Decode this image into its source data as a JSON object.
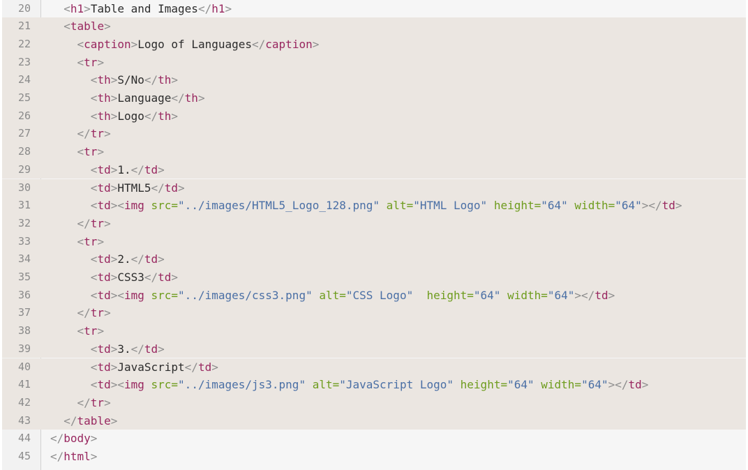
{
  "editor": {
    "highlight_color": "#ebe6e1",
    "highlighted_lines": [
      "21",
      "22",
      "23",
      "24",
      "25",
      "26",
      "27",
      "28",
      "29",
      "30",
      "31",
      "32",
      "33",
      "34",
      "35",
      "36",
      "37",
      "38",
      "39",
      "40",
      "41",
      "42",
      "43"
    ],
    "lines": [
      {
        "number": "20",
        "indent": "  ",
        "tokens": [
          {
            "t": "p",
            "v": "<"
          },
          {
            "t": "t",
            "v": "h1"
          },
          {
            "t": "p",
            "v": ">"
          },
          {
            "t": "x",
            "v": "Table and Images"
          },
          {
            "t": "p",
            "v": "</"
          },
          {
            "t": "t",
            "v": "h1"
          },
          {
            "t": "p",
            "v": ">"
          }
        ]
      },
      {
        "number": "21",
        "indent": "  ",
        "tokens": [
          {
            "t": "p",
            "v": "<"
          },
          {
            "t": "t",
            "v": "table"
          },
          {
            "t": "p",
            "v": ">"
          }
        ]
      },
      {
        "number": "22",
        "indent": "    ",
        "tokens": [
          {
            "t": "p",
            "v": "<"
          },
          {
            "t": "t",
            "v": "caption"
          },
          {
            "t": "p",
            "v": ">"
          },
          {
            "t": "x",
            "v": "Logo of Languages"
          },
          {
            "t": "p",
            "v": "</"
          },
          {
            "t": "t",
            "v": "caption"
          },
          {
            "t": "p",
            "v": ">"
          }
        ]
      },
      {
        "number": "23",
        "indent": "    ",
        "tokens": [
          {
            "t": "p",
            "v": "<"
          },
          {
            "t": "t",
            "v": "tr"
          },
          {
            "t": "p",
            "v": ">"
          }
        ]
      },
      {
        "number": "24",
        "indent": "      ",
        "tokens": [
          {
            "t": "p",
            "v": "<"
          },
          {
            "t": "t",
            "v": "th"
          },
          {
            "t": "p",
            "v": ">"
          },
          {
            "t": "x",
            "v": "S/No"
          },
          {
            "t": "p",
            "v": "</"
          },
          {
            "t": "t",
            "v": "th"
          },
          {
            "t": "p",
            "v": ">"
          }
        ]
      },
      {
        "number": "25",
        "indent": "      ",
        "tokens": [
          {
            "t": "p",
            "v": "<"
          },
          {
            "t": "t",
            "v": "th"
          },
          {
            "t": "p",
            "v": ">"
          },
          {
            "t": "x",
            "v": "Language"
          },
          {
            "t": "p",
            "v": "</"
          },
          {
            "t": "t",
            "v": "th"
          },
          {
            "t": "p",
            "v": ">"
          }
        ]
      },
      {
        "number": "26",
        "indent": "      ",
        "tokens": [
          {
            "t": "p",
            "v": "<"
          },
          {
            "t": "t",
            "v": "th"
          },
          {
            "t": "p",
            "v": ">"
          },
          {
            "t": "x",
            "v": "Logo"
          },
          {
            "t": "p",
            "v": "</"
          },
          {
            "t": "t",
            "v": "th"
          },
          {
            "t": "p",
            "v": ">"
          }
        ]
      },
      {
        "number": "27",
        "indent": "    ",
        "tokens": [
          {
            "t": "p",
            "v": "</"
          },
          {
            "t": "t",
            "v": "tr"
          },
          {
            "t": "p",
            "v": ">"
          }
        ]
      },
      {
        "number": "28",
        "indent": "    ",
        "tokens": [
          {
            "t": "p",
            "v": "<"
          },
          {
            "t": "t",
            "v": "tr"
          },
          {
            "t": "p",
            "v": ">"
          }
        ]
      },
      {
        "number": "29",
        "indent": "      ",
        "tokens": [
          {
            "t": "p",
            "v": "<"
          },
          {
            "t": "t",
            "v": "td"
          },
          {
            "t": "p",
            "v": ">"
          },
          {
            "t": "x",
            "v": "1."
          },
          {
            "t": "p",
            "v": "</"
          },
          {
            "t": "t",
            "v": "td"
          },
          {
            "t": "p",
            "v": ">"
          }
        ]
      },
      {
        "number": "30",
        "indent": "      ",
        "tokens": [
          {
            "t": "p",
            "v": "<"
          },
          {
            "t": "t",
            "v": "td"
          },
          {
            "t": "p",
            "v": ">"
          },
          {
            "t": "x",
            "v": "HTML5"
          },
          {
            "t": "p",
            "v": "</"
          },
          {
            "t": "t",
            "v": "td"
          },
          {
            "t": "p",
            "v": ">"
          }
        ]
      },
      {
        "number": "31",
        "indent": "      ",
        "tokens": [
          {
            "t": "p",
            "v": "<"
          },
          {
            "t": "t",
            "v": "td"
          },
          {
            "t": "p",
            "v": "><"
          },
          {
            "t": "t",
            "v": "img"
          },
          {
            "t": "x",
            "v": " "
          },
          {
            "t": "a",
            "v": "src="
          },
          {
            "t": "v",
            "v": "\"../images/HTML5_Logo_128.png\""
          },
          {
            "t": "x",
            "v": " "
          },
          {
            "t": "a",
            "v": "alt="
          },
          {
            "t": "v",
            "v": "\"HTML Logo\""
          },
          {
            "t": "x",
            "v": " "
          },
          {
            "t": "a",
            "v": "height="
          },
          {
            "t": "v",
            "v": "\"64\""
          },
          {
            "t": "x",
            "v": " "
          },
          {
            "t": "a",
            "v": "width="
          },
          {
            "t": "v",
            "v": "\"64\""
          },
          {
            "t": "p",
            "v": "></"
          },
          {
            "t": "t",
            "v": "td"
          },
          {
            "t": "p",
            "v": ">"
          }
        ]
      },
      {
        "number": "32",
        "indent": "    ",
        "tokens": [
          {
            "t": "p",
            "v": "</"
          },
          {
            "t": "t",
            "v": "tr"
          },
          {
            "t": "p",
            "v": ">"
          }
        ]
      },
      {
        "number": "33",
        "indent": "    ",
        "tokens": [
          {
            "t": "p",
            "v": "<"
          },
          {
            "t": "t",
            "v": "tr"
          },
          {
            "t": "p",
            "v": ">"
          }
        ]
      },
      {
        "number": "34",
        "indent": "      ",
        "tokens": [
          {
            "t": "p",
            "v": "<"
          },
          {
            "t": "t",
            "v": "td"
          },
          {
            "t": "p",
            "v": ">"
          },
          {
            "t": "x",
            "v": "2."
          },
          {
            "t": "p",
            "v": "</"
          },
          {
            "t": "t",
            "v": "td"
          },
          {
            "t": "p",
            "v": ">"
          }
        ]
      },
      {
        "number": "35",
        "indent": "      ",
        "tokens": [
          {
            "t": "p",
            "v": "<"
          },
          {
            "t": "t",
            "v": "td"
          },
          {
            "t": "p",
            "v": ">"
          },
          {
            "t": "x",
            "v": "CSS3"
          },
          {
            "t": "p",
            "v": "</"
          },
          {
            "t": "t",
            "v": "td"
          },
          {
            "t": "p",
            "v": ">"
          }
        ]
      },
      {
        "number": "36",
        "indent": "      ",
        "tokens": [
          {
            "t": "p",
            "v": "<"
          },
          {
            "t": "t",
            "v": "td"
          },
          {
            "t": "p",
            "v": "><"
          },
          {
            "t": "t",
            "v": "img"
          },
          {
            "t": "x",
            "v": " "
          },
          {
            "t": "a",
            "v": "src="
          },
          {
            "t": "v",
            "v": "\"../images/css3.png\""
          },
          {
            "t": "x",
            "v": " "
          },
          {
            "t": "a",
            "v": "alt="
          },
          {
            "t": "v",
            "v": "\"CSS Logo\""
          },
          {
            "t": "x",
            "v": "  "
          },
          {
            "t": "a",
            "v": "height="
          },
          {
            "t": "v",
            "v": "\"64\""
          },
          {
            "t": "x",
            "v": " "
          },
          {
            "t": "a",
            "v": "width="
          },
          {
            "t": "v",
            "v": "\"64\""
          },
          {
            "t": "p",
            "v": "></"
          },
          {
            "t": "t",
            "v": "td"
          },
          {
            "t": "p",
            "v": ">"
          }
        ]
      },
      {
        "number": "37",
        "indent": "    ",
        "tokens": [
          {
            "t": "p",
            "v": "</"
          },
          {
            "t": "t",
            "v": "tr"
          },
          {
            "t": "p",
            "v": ">"
          }
        ]
      },
      {
        "number": "38",
        "indent": "    ",
        "tokens": [
          {
            "t": "p",
            "v": "<"
          },
          {
            "t": "t",
            "v": "tr"
          },
          {
            "t": "p",
            "v": ">"
          }
        ]
      },
      {
        "number": "39",
        "indent": "      ",
        "tokens": [
          {
            "t": "p",
            "v": "<"
          },
          {
            "t": "t",
            "v": "td"
          },
          {
            "t": "p",
            "v": ">"
          },
          {
            "t": "x",
            "v": "3."
          },
          {
            "t": "p",
            "v": "</"
          },
          {
            "t": "t",
            "v": "td"
          },
          {
            "t": "p",
            "v": ">"
          }
        ]
      },
      {
        "number": "40",
        "indent": "      ",
        "tokens": [
          {
            "t": "p",
            "v": "<"
          },
          {
            "t": "t",
            "v": "td"
          },
          {
            "t": "p",
            "v": ">"
          },
          {
            "t": "x",
            "v": "JavaScript"
          },
          {
            "t": "p",
            "v": "</"
          },
          {
            "t": "t",
            "v": "td"
          },
          {
            "t": "p",
            "v": ">"
          }
        ]
      },
      {
        "number": "41",
        "indent": "      ",
        "tokens": [
          {
            "t": "p",
            "v": "<"
          },
          {
            "t": "t",
            "v": "td"
          },
          {
            "t": "p",
            "v": "><"
          },
          {
            "t": "t",
            "v": "img"
          },
          {
            "t": "x",
            "v": " "
          },
          {
            "t": "a",
            "v": "src="
          },
          {
            "t": "v",
            "v": "\"../images/js3.png\""
          },
          {
            "t": "x",
            "v": " "
          },
          {
            "t": "a",
            "v": "alt="
          },
          {
            "t": "v",
            "v": "\"JavaScript Logo\""
          },
          {
            "t": "x",
            "v": " "
          },
          {
            "t": "a",
            "v": "height="
          },
          {
            "t": "v",
            "v": "\"64\""
          },
          {
            "t": "x",
            "v": " "
          },
          {
            "t": "a",
            "v": "width="
          },
          {
            "t": "v",
            "v": "\"64\""
          },
          {
            "t": "p",
            "v": "></"
          },
          {
            "t": "t",
            "v": "td"
          },
          {
            "t": "p",
            "v": ">"
          }
        ]
      },
      {
        "number": "42",
        "indent": "    ",
        "tokens": [
          {
            "t": "p",
            "v": "</"
          },
          {
            "t": "t",
            "v": "tr"
          },
          {
            "t": "p",
            "v": ">"
          }
        ]
      },
      {
        "number": "43",
        "indent": "  ",
        "tokens": [
          {
            "t": "p",
            "v": "</"
          },
          {
            "t": "t",
            "v": "table"
          },
          {
            "t": "p",
            "v": ">"
          }
        ]
      },
      {
        "number": "44",
        "indent": "",
        "tokens": [
          {
            "t": "p",
            "v": "</"
          },
          {
            "t": "t",
            "v": "body"
          },
          {
            "t": "p",
            "v": ">"
          }
        ]
      },
      {
        "number": "45",
        "indent": "",
        "tokens": [
          {
            "t": "p",
            "v": "</"
          },
          {
            "t": "t",
            "v": "html"
          },
          {
            "t": "p",
            "v": ">"
          }
        ]
      }
    ]
  }
}
